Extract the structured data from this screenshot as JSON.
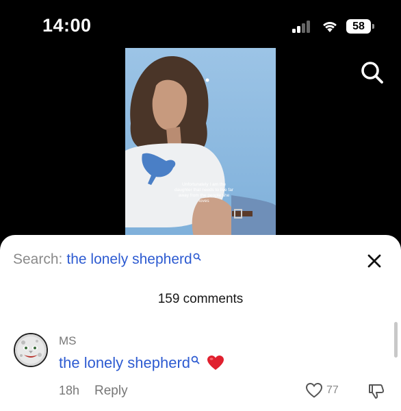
{
  "status_bar": {
    "time": "14:00",
    "battery": "58"
  },
  "video": {
    "caption": "Unfortunately I am the daughter that needs to live far away from the people she loves"
  },
  "comments_sheet": {
    "search_label": "Search:",
    "search_query": "the lonely shepherd",
    "comment_count": "159 comments",
    "comments": [
      {
        "author": "MS",
        "text": "the lonely shepherd",
        "time": "18h",
        "reply_label": "Reply",
        "likes": "77"
      }
    ]
  },
  "colors": {
    "link_blue": "#2d5bd1",
    "sheet_bg": "#ffffff",
    "muted_text": "#777777",
    "heart_red": "#e0202e"
  },
  "icons": {
    "top_search": "search-icon",
    "close": "close-icon",
    "like": "heart-outline-icon",
    "dislike": "thumbs-down-icon"
  }
}
